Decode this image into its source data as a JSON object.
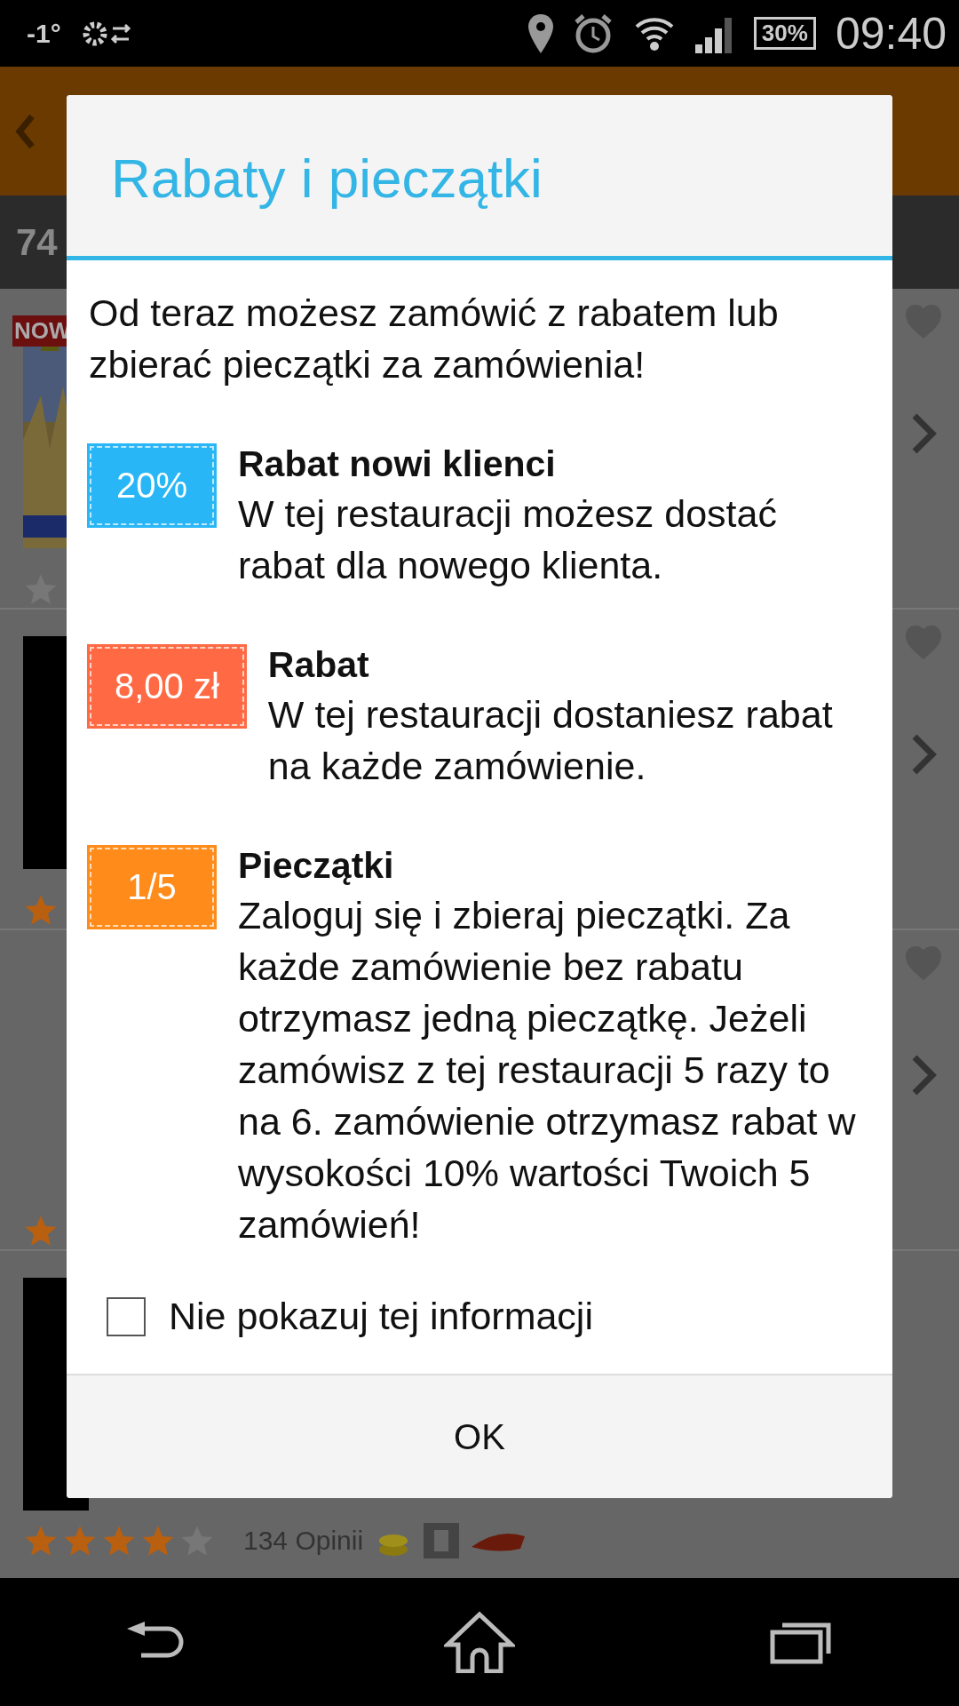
{
  "status_bar": {
    "temperature": "-1°",
    "battery": "30%",
    "time": "09:40"
  },
  "background": {
    "count": "74",
    "badge": "NOW",
    "rows": [
      {
        "kind": "picture",
        "first_star_filled": false
      },
      {
        "kind": "black",
        "first_star_filled": true
      },
      {
        "kind": "empty",
        "first_star_filled": true
      },
      {
        "kind": "black",
        "stars": 4,
        "reviews": "134 Opinii"
      }
    ]
  },
  "dialog": {
    "title": "Rabaty i pieczątki",
    "intro": "Od teraz możesz zamówić z rabatem lub zbierać pieczątki za zamówienia!",
    "items": [
      {
        "badge": "20%",
        "color": "#29b6f6",
        "heading": "Rabat nowi klienci",
        "text": "W tej restauracji możesz dostać rabat dla nowego klienta."
      },
      {
        "badge": "8,00 zł",
        "color": "#ff6a45",
        "heading": "Rabat",
        "text": "W tej restauracji dostaniesz rabat na każde zamówienie."
      },
      {
        "badge": "1/5",
        "color": "#ff8c1a",
        "heading": "Pieczątki",
        "text": "Zaloguj się i zbieraj pieczątki. Za każde zamówienie bez rabatu otrzymasz jedną pieczątkę. Jeżeli zamówisz z tej restauracji 5 razy to na 6. zamówienie otrzymasz rabat w wysokości 10% wartości Twoich 5 zamówień!"
      }
    ],
    "checkbox": {
      "label": "Nie pokazuj tej informacji",
      "checked": false
    },
    "button": "OK"
  }
}
